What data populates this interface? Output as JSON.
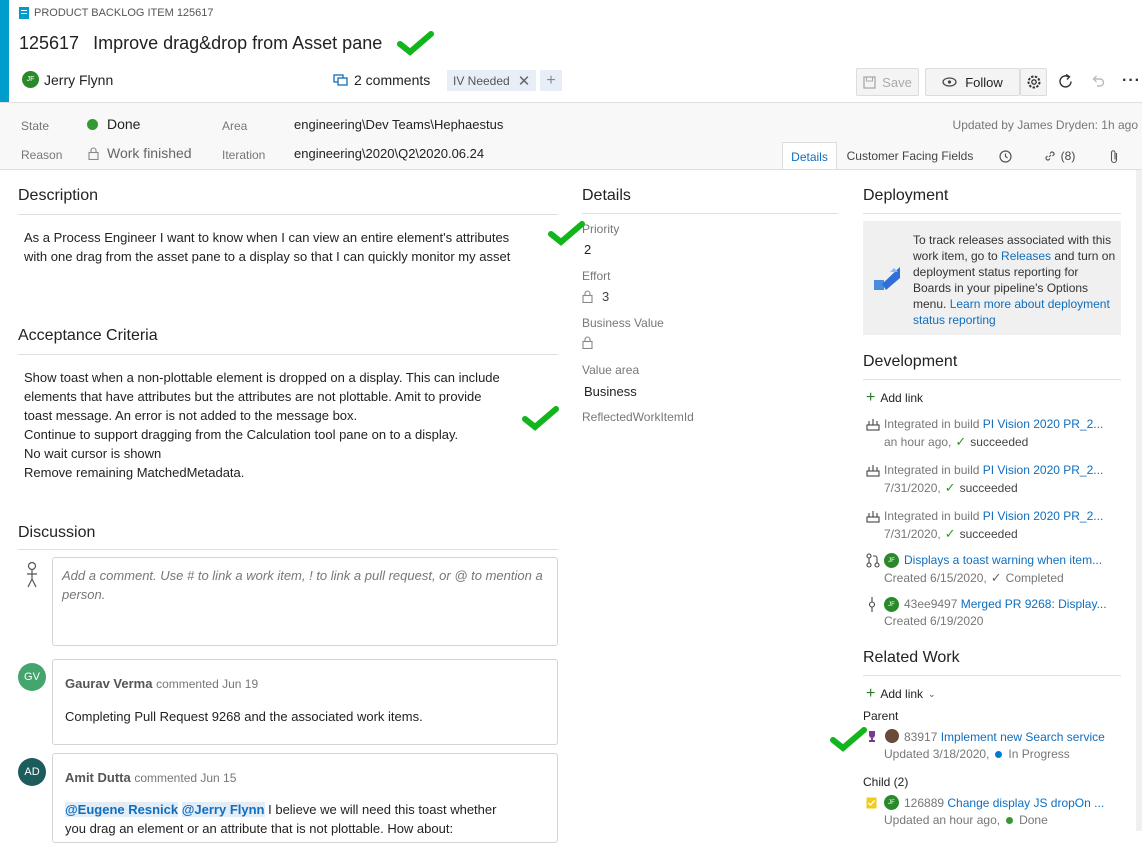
{
  "header": {
    "type_label": "PRODUCT BACKLOG ITEM 125617",
    "id": "125617",
    "title": "Improve drag&drop from Asset pane",
    "assignee": "Jerry Flynn",
    "assignee_initials": "JF",
    "comments": "2 comments",
    "tag": "IV Needed",
    "save_label": "Save",
    "follow_label": "Follow"
  },
  "fields": {
    "state_label": "State",
    "state_value": "Done",
    "reason_label": "Reason",
    "reason_value": "Work finished",
    "area_label": "Area",
    "area_value": "engineering\\Dev Teams\\Hephaestus",
    "iteration_label": "Iteration",
    "iteration_value": "engineering\\2020\\Q2\\2020.06.24",
    "updated": "Updated by James Dryden: 1h ago"
  },
  "tabs": {
    "details": "Details",
    "customer": "Customer Facing Fields",
    "links_count": "(8)"
  },
  "description": {
    "title": "Description",
    "line1": "As a Process Engineer I want to know when I can view an entire element's attributes",
    "line2": "with one drag from the asset pane to a display so that I can quickly monitor my asset"
  },
  "acceptance": {
    "title": "Acceptance Criteria",
    "lines": [
      "Show toast when a non-plottable element is dropped on a display. This can include",
      "elements that have attributes but the attributes are not plottable. Amit to provide",
      "toast message. An error is not added to the message box.",
      "Continue to support dragging from the Calculation tool pane on to a display.",
      "No wait cursor is shown",
      "Remove remaining MatchedMetadata."
    ]
  },
  "discussion": {
    "title": "Discussion",
    "placeholder": "Add a comment. Use # to link a work item, ! to link a pull request, or @ to mention a person.",
    "comments": [
      {
        "initials": "GV",
        "author": "Gaurav Verma",
        "meta": "commented Jun 19",
        "text": "Completing Pull Request 9268 and the associated work items."
      },
      {
        "initials": "AD",
        "author": "Amit Dutta",
        "meta": "commented Jun 15",
        "mention1": "@Eugene Resnick",
        "mention2": "@Jerry Flynn",
        "text": " I believe we will need this toast whether",
        "text2": "you drag an element or an attribute that is not plottable.  How about:"
      }
    ]
  },
  "details": {
    "title": "Details",
    "priority_label": "Priority",
    "priority_value": "2",
    "effort_label": "Effort",
    "effort_value": "3",
    "business_value_label": "Business Value",
    "value_area_label": "Value area",
    "value_area_value": "Business",
    "reflected_label": "ReflectedWorkItemId"
  },
  "deployment": {
    "title": "Deployment",
    "text_pre": "To track releases associated with this work item, go to ",
    "releases_link": "Releases",
    "text_mid": " and turn on deployment status reporting for Boards in your pipeline's Options menu. ",
    "learn_link": "Learn more about deployment status reporting"
  },
  "development": {
    "title": "Development",
    "add_link": "Add link",
    "items": [
      {
        "prefix": "Integrated in build ",
        "link": "PI Vision 2020 PR_2...",
        "date": "an hour ago,",
        "status": "succeeded"
      },
      {
        "prefix": "Integrated in build ",
        "link": "PI Vision 2020 PR_2...",
        "date": "7/31/2020,",
        "status": "succeeded"
      },
      {
        "prefix": "Integrated in build ",
        "link": "PI Vision 2020 PR_2...",
        "date": "7/31/2020,",
        "status": "succeeded"
      },
      {
        "link": "Displays a toast warning when item...",
        "date": "Created 6/15/2020,",
        "status": "Completed"
      },
      {
        "id": "43ee9497",
        "link": "Merged PR 9268: Display...",
        "date": "Created 6/19/2020"
      }
    ]
  },
  "related": {
    "title": "Related Work",
    "add_link": "Add link",
    "parent_label": "Parent",
    "parent_id": "83917",
    "parent_link": "Implement new Search service",
    "parent_updated": "Updated 3/18/2020,",
    "parent_status": "In Progress",
    "child_label": "Child (2)",
    "child_id": "126889",
    "child_link": "Change display JS dropOn ...",
    "child_updated": "Updated an hour ago,",
    "child_status": "Done"
  },
  "colors": {
    "accent": "#009ccc",
    "link": "#106ebe",
    "success": "#13b51d",
    "done_green": "#339933",
    "in_progress_blue": "#007acc"
  }
}
